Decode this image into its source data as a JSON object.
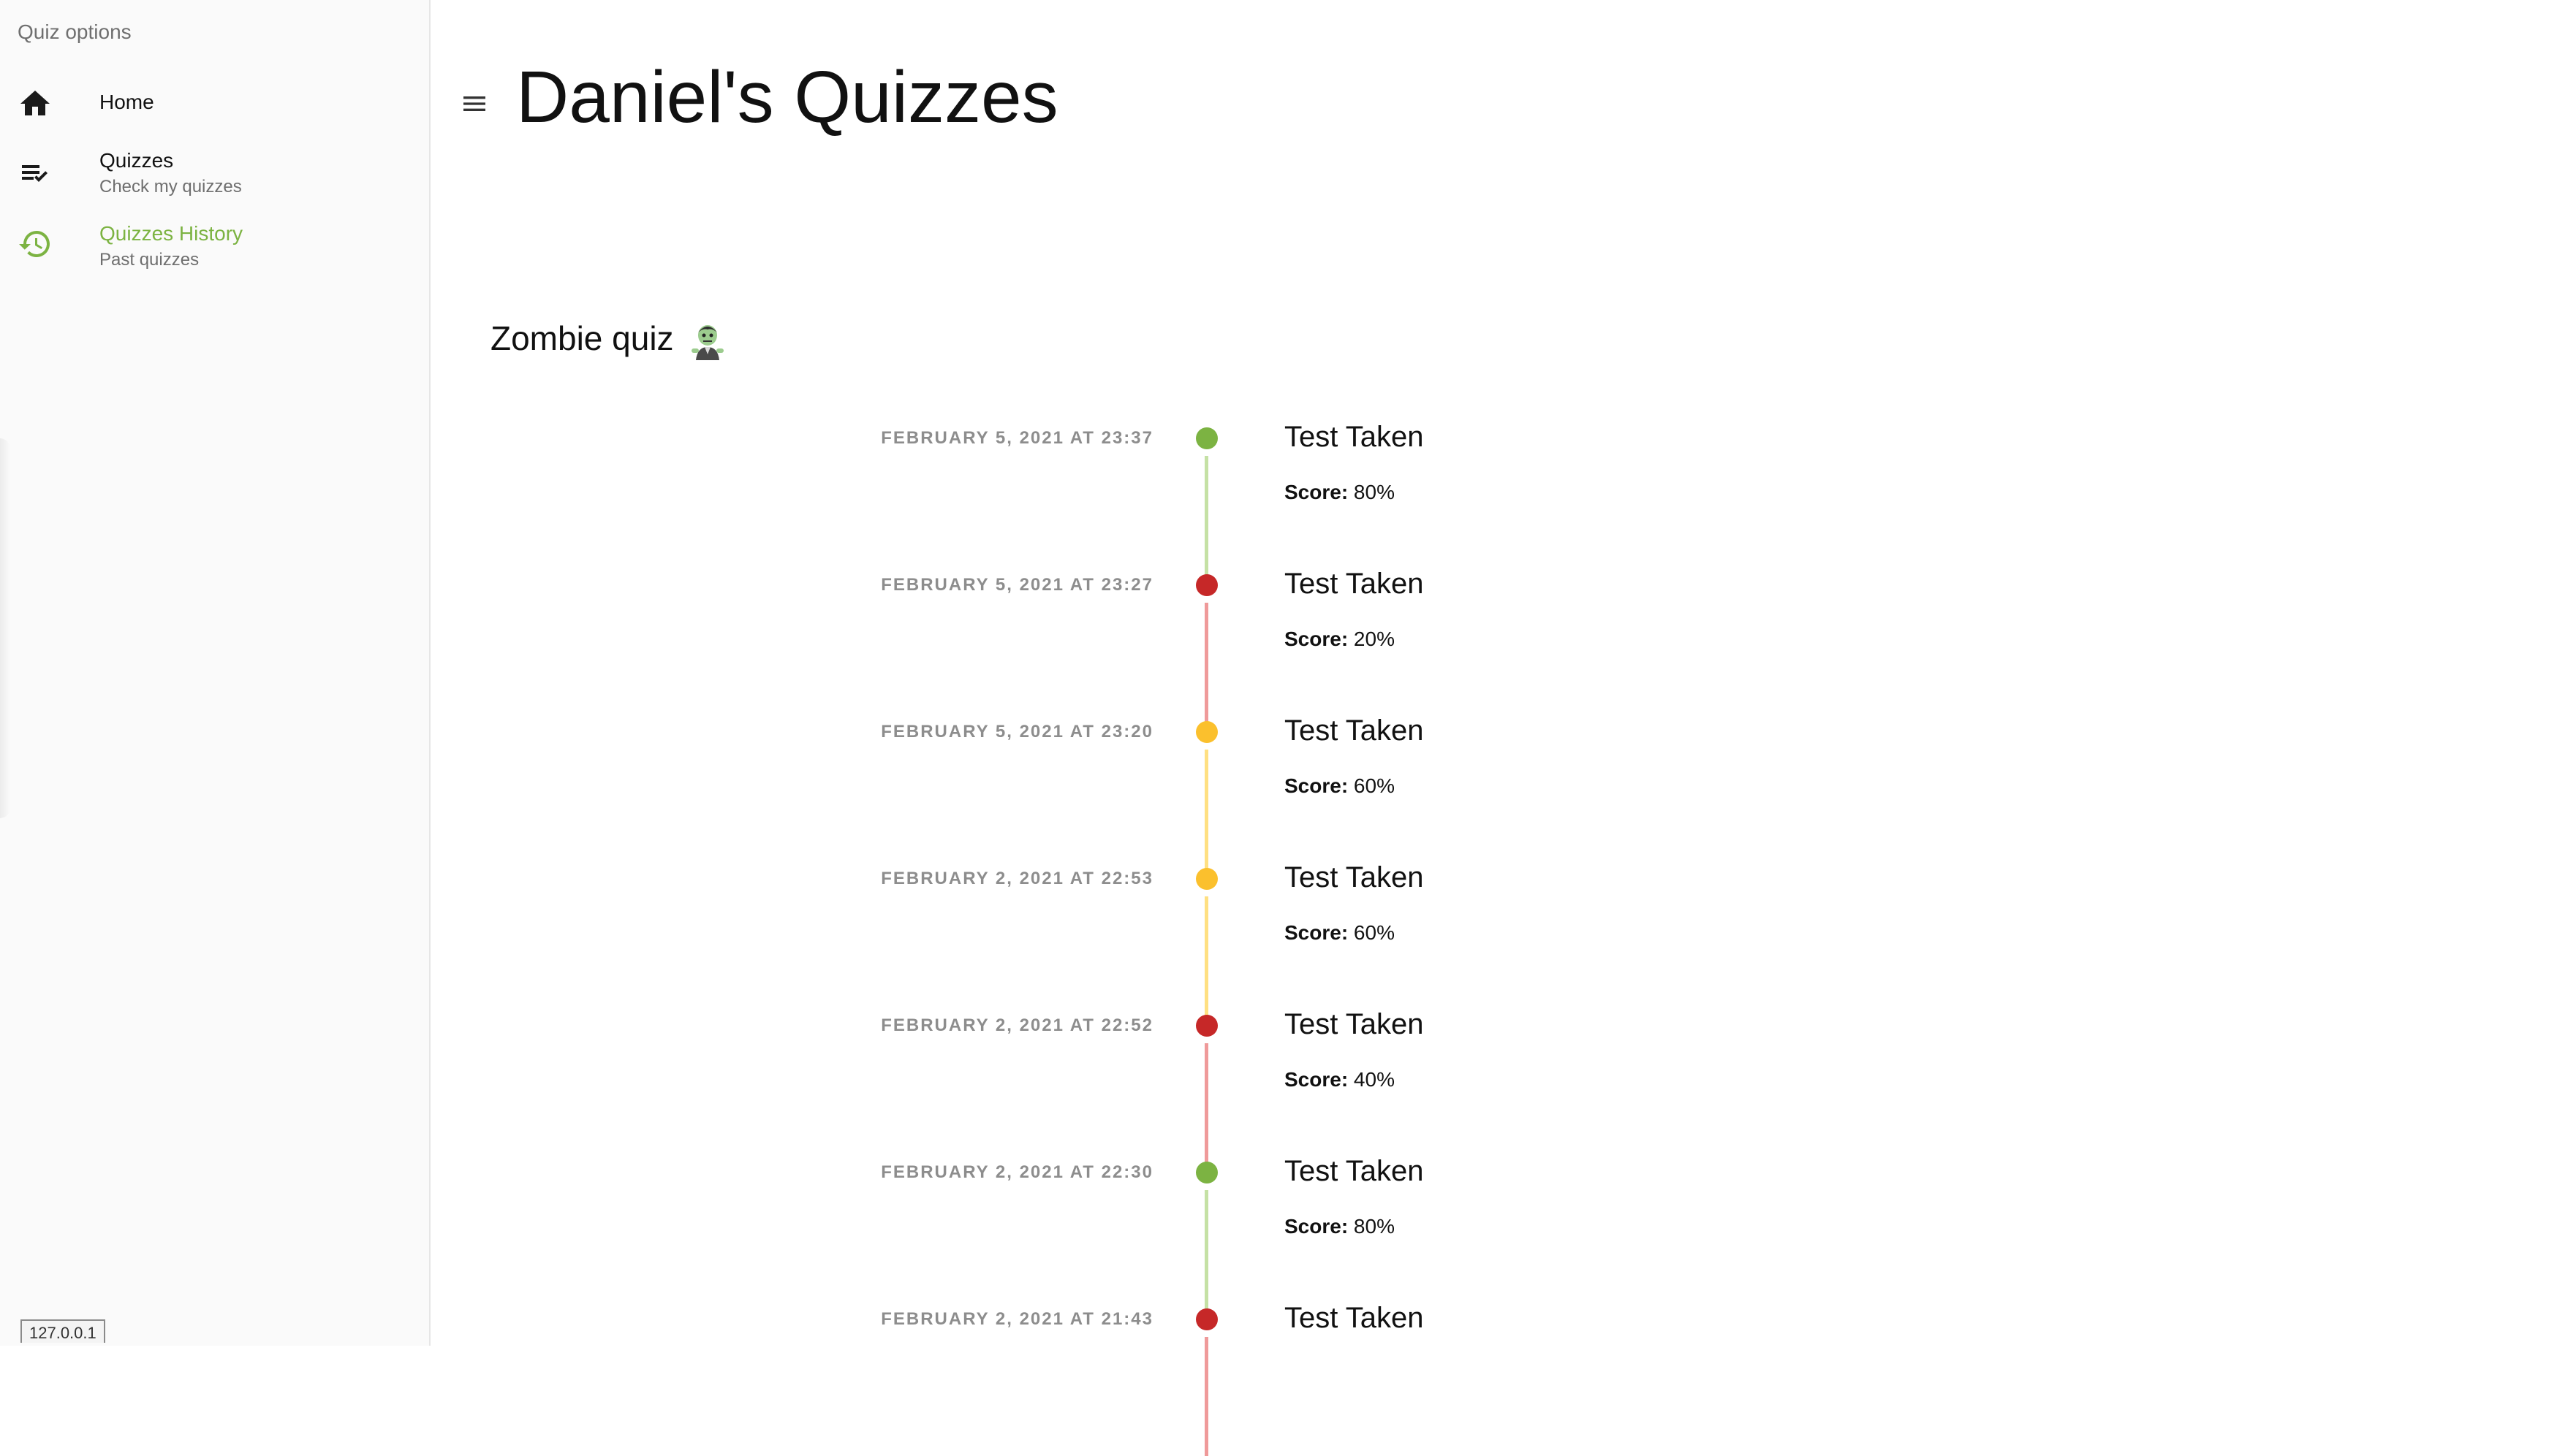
{
  "sidebar": {
    "title": "Quiz options",
    "items": [
      {
        "icon": "home-icon",
        "label": "Home",
        "sub": ""
      },
      {
        "icon": "playlist-check-icon",
        "label": "Quizzes",
        "sub": "Check my quizzes"
      },
      {
        "icon": "history-icon",
        "label": "Quizzes History",
        "sub": "Past quizzes",
        "active": true
      }
    ],
    "ip_badge": "127.0.0.1"
  },
  "header": {
    "menu_icon": "hamburger-menu-icon",
    "title": "Daniel's Quizzes"
  },
  "quiz": {
    "title": "Zombie quiz",
    "emoji_icon": "zombie-emoji-icon"
  },
  "colors": {
    "green": "#7cb342",
    "green_line": "#c5e1a5",
    "red": "#c62828",
    "red_line": "#ef9a9a",
    "yellow": "#fbc02d",
    "yellow_line": "#ffe082",
    "active_nav": "#7cb342"
  },
  "timeline": [
    {
      "date": "FEBRUARY 5, 2021 AT 23:37",
      "heading": "Test Taken",
      "score_label": "Score:",
      "score": "80%",
      "status": "green"
    },
    {
      "date": "FEBRUARY 5, 2021 AT 23:27",
      "heading": "Test Taken",
      "score_label": "Score:",
      "score": "20%",
      "status": "red"
    },
    {
      "date": "FEBRUARY 5, 2021 AT 23:20",
      "heading": "Test Taken",
      "score_label": "Score:",
      "score": "60%",
      "status": "yellow"
    },
    {
      "date": "FEBRUARY 2, 2021 AT 22:53",
      "heading": "Test Taken",
      "score_label": "Score:",
      "score": "60%",
      "status": "yellow"
    },
    {
      "date": "FEBRUARY 2, 2021 AT 22:52",
      "heading": "Test Taken",
      "score_label": "Score:",
      "score": "40%",
      "status": "red"
    },
    {
      "date": "FEBRUARY 2, 2021 AT 22:30",
      "heading": "Test Taken",
      "score_label": "Score:",
      "score": "80%",
      "status": "green"
    },
    {
      "date": "FEBRUARY 2, 2021 AT 21:43",
      "heading": "Test Taken",
      "score_label": "",
      "score": "",
      "status": "red"
    }
  ]
}
